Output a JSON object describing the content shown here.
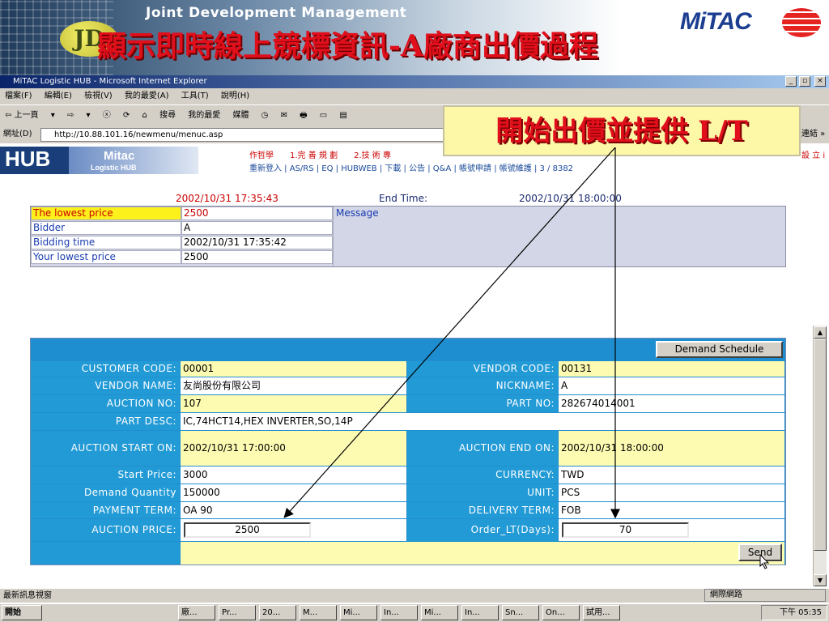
{
  "banner": {
    "subtitle": "Joint Development Management",
    "jd_logo": "JD",
    "title": "顯示即時線上競標資訊-A廠商出價過程",
    "brand_logo": "MiTAC",
    "ball_icon": "mitac-ball-icon"
  },
  "window": {
    "title": "MiTAC Logistic HUB - Microsoft Internet Explorer",
    "controls": [
      "_",
      "▫",
      "×"
    ],
    "menu": [
      "檔案(F)",
      "編輯(E)",
      "檢視(V)",
      "我的最愛(A)",
      "工具(T)",
      "說明(H)"
    ],
    "toolbar": [
      "⇦ 上一頁",
      "▾",
      "⇨",
      "▾",
      "ⓧ",
      "⟳",
      "⌂",
      "搜尋",
      "我的最愛",
      "媒體",
      "◷",
      "✉",
      "🖶",
      "▭",
      "▤"
    ],
    "address_label": "網址(D)",
    "address": "http://10.88.101.16/newmenu/menuc.asp",
    "links_label": "連結 »"
  },
  "hub": {
    "logo": "HUB",
    "brand": "Mitac",
    "sub": "Logistic HUB",
    "nav_top": "作哲學　　1.完 善 規 劃　　2.技 術 專",
    "nav_bottom": "重新登入 | AS/RS | EQ | HUBWEB | 下載 | 公告 | Q&A | 帳號申請 | 帳號維護 | 3 / 8382",
    "nav_right": "設 立 i"
  },
  "bidding": {
    "current_time": "2002/10/31 17:35:43",
    "end_label": "End Time:",
    "end_time": "2002/10/31 18:00:00",
    "rows": [
      {
        "label": "The lowest price",
        "value": "2500"
      },
      {
        "label": "Bidder",
        "value": "A"
      },
      {
        "label": "Bidding time",
        "value": "2002/10/31 17:35:42"
      },
      {
        "label": "Your lowest price",
        "value": "2500"
      }
    ],
    "message_label": "Message"
  },
  "form": {
    "demand_schedule_btn": "Demand Schedule",
    "customer_code_label": "CUSTOMER CODE:",
    "customer_code": "00001",
    "vendor_code_label": "VENDOR CODE:",
    "vendor_code": "00131",
    "vendor_name_label": "VENDOR NAME:",
    "vendor_name": "友尚股份有限公司",
    "nickname_label": "NICKNAME:",
    "nickname": "A",
    "auction_no_label": "AUCTION NO:",
    "auction_no": "107",
    "part_no_label": "PART NO:",
    "part_no": "282674014001",
    "part_desc_label": "PART DESC:",
    "part_desc": "IC,74HCT14,HEX INVERTER,SO,14P",
    "auction_start_label": "AUCTION START ON:",
    "auction_start": "2002/10/31 17:00:00",
    "auction_end_label": "AUCTION END ON:",
    "auction_end": "2002/10/31 18:00:00",
    "start_price_label": "Start  Price:",
    "start_price": "3000",
    "currency_label": "CURRENCY:",
    "currency": "TWD",
    "demand_qty_label": "Demand Quantity",
    "demand_qty": "150000",
    "unit_label": "UNIT:",
    "unit": "PCS",
    "payment_term_label": "PAYMENT TERM:",
    "payment_term": "OA 90",
    "delivery_term_label": "DELIVERY TERM:",
    "delivery_term": "FOB",
    "auction_price_label": "AUCTION PRICE:",
    "auction_price": "2500",
    "order_lt_label": "Order_LT(Days):",
    "order_lt": "70",
    "send_btn": "Send"
  },
  "callout": "開始出價並提供 L/T",
  "status": {
    "text": "最新訊息視窗",
    "zone": "網際網路"
  },
  "taskbar": {
    "start": "開始",
    "tasks": [
      "廠...",
      "Pr...",
      "20...",
      "M...",
      "Mi...",
      "In...",
      "Mi...",
      "In...",
      "Sn...",
      "On...",
      "試用..."
    ],
    "clock": "下午 05:35"
  }
}
